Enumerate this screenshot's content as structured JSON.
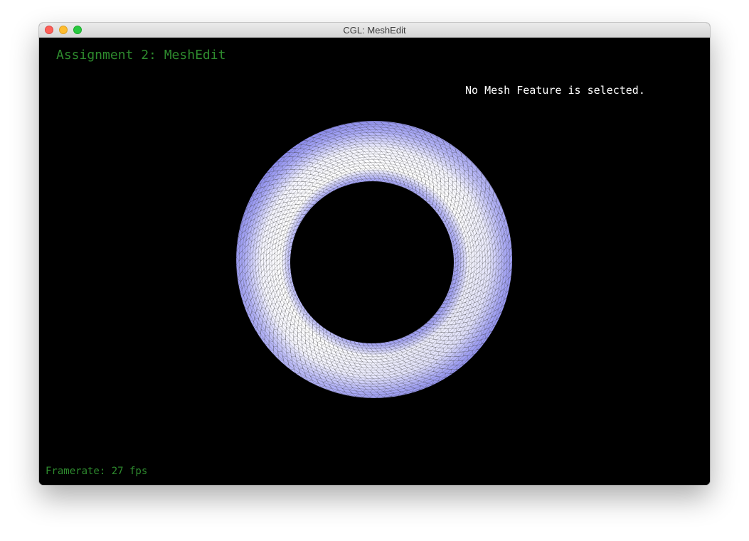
{
  "window": {
    "title": "CGL: MeshEdit"
  },
  "viewport": {
    "assignment_title": "Assignment 2: MeshEdit",
    "selection_status": "No Mesh Feature is selected.",
    "framerate": "Framerate: 27 fps"
  },
  "mesh": {
    "shape": "torus",
    "fill_light": "#ffffff",
    "fill_shade": "#8a8af2",
    "wire_color": "#3a3a3a",
    "background": "#000000"
  },
  "colors": {
    "hud_green": "#2e8b2e",
    "hud_white": "#ffffff"
  }
}
